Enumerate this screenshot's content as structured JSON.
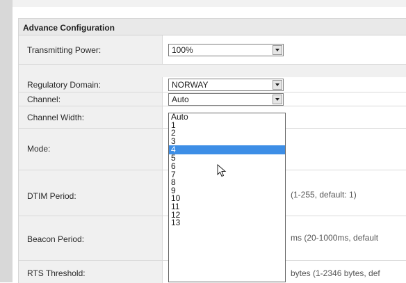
{
  "panel": {
    "title": "Advance Configuration"
  },
  "rows": {
    "transmitting_power": {
      "label": "Transmitting Power:",
      "value": "100%"
    },
    "regulatory_domain": {
      "label": "Regulatory Domain:",
      "value": "NORWAY"
    },
    "channel": {
      "label": "Channel:",
      "value": "Auto"
    },
    "channel_width": {
      "label": "Channel Width:"
    },
    "mode": {
      "label": "Mode:"
    },
    "dtim_period": {
      "label": "DTIM Period:",
      "hint": "(1-255, default: 1)"
    },
    "beacon_period": {
      "label": "Beacon Period:",
      "hint": "ms (20-1000ms, default"
    },
    "rts_threshold": {
      "label": "RTS Threshold:",
      "hint": "bytes (1-2346 bytes, def"
    }
  },
  "channel_dropdown": {
    "options": [
      "Auto",
      "1",
      "2",
      "3",
      "4",
      "5",
      "6",
      "7",
      "8",
      "9",
      "10",
      "11",
      "12",
      "13"
    ],
    "highlighted": "4"
  },
  "icons": {
    "select_arrow": "chevron-down-icon",
    "cursor": "mouse-pointer-icon"
  },
  "colors": {
    "highlight": "#3d8ee6",
    "panel_bg": "#f0f0f0",
    "header_bg": "#e9e9e9"
  }
}
